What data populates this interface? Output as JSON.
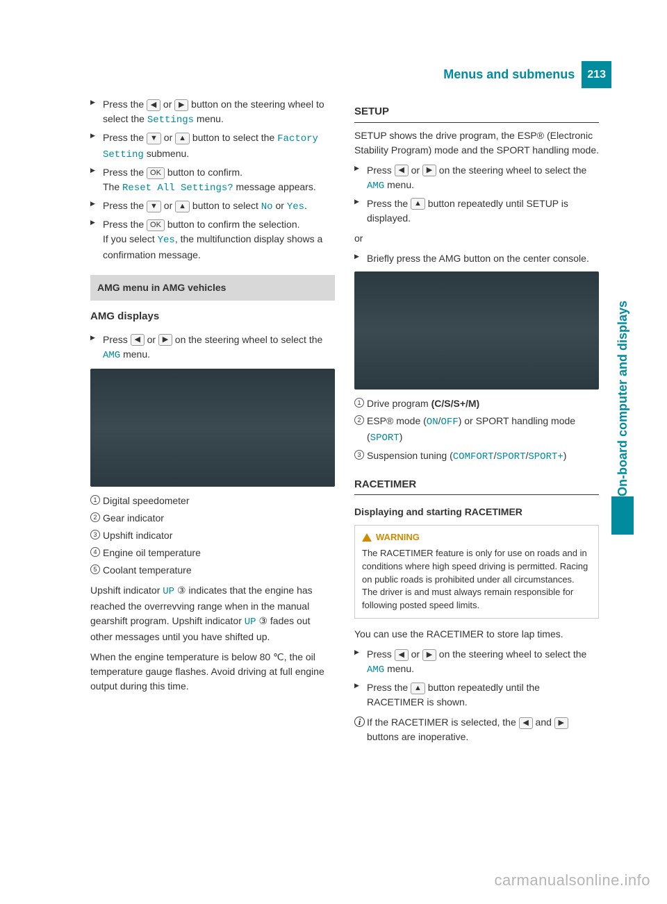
{
  "header": {
    "title": "Menus and submenus",
    "page": "213"
  },
  "side_tab": "On-board computer and displays",
  "left": {
    "steps_a": [
      {
        "pre": "Press the ",
        "b1": "◀",
        "mid1": " or ",
        "b2": "▶",
        "post": " button on the steering wheel to select the ",
        "tt": "Settings",
        "post2": " menu."
      },
      {
        "pre": "Press the ",
        "b1": "▼",
        "mid1": " or ",
        "b2": "▲",
        "post": " button to select the ",
        "tt": "Factory Setting",
        "post2": " submenu."
      },
      {
        "pre": "Press the ",
        "b1": "OK",
        "post": " button to confirm.",
        "br": true,
        "after_pre": "The ",
        "after_tt": "Reset All Settings?",
        "after_post": " message appears."
      },
      {
        "pre": "Press the ",
        "b1": "▼",
        "mid1": " or ",
        "b2": "▲",
        "post": " button to select ",
        "tt": "No",
        "mid2": " or ",
        "tt2": "Yes",
        "post2": "."
      },
      {
        "pre": "Press the ",
        "b1": "OK",
        "post": " button to confirm the selection.",
        "br": true,
        "after_pre": "If you select ",
        "after_tt": "Yes",
        "after_post": ", the multifunction display shows a confirmation message."
      }
    ],
    "section_bar": "AMG menu in AMG vehicles",
    "amg_displays": "AMG displays",
    "step_b": {
      "pre": "Press ",
      "b1": "◀",
      "mid1": " or ",
      "b2": "▶",
      "post": " on the steering wheel to select the ",
      "tt": "AMG",
      "post2": " menu."
    },
    "callouts": [
      {
        "n": "1",
        "t": "Digital speedometer"
      },
      {
        "n": "2",
        "t": "Gear indicator"
      },
      {
        "n": "3",
        "t": "Upshift indicator"
      },
      {
        "n": "4",
        "t": "Engine oil temperature"
      },
      {
        "n": "5",
        "t": "Coolant temperature"
      }
    ],
    "para1_a": "Upshift indicator ",
    "para1_tt": "UP",
    "para1_b": " ③ indicates that the engine has reached the overrevving range when in the manual gearshift program. Upshift indicator ",
    "para1_tt2": "UP",
    "para1_c": " ③ fades out other messages until you have shifted up.",
    "para2": "When the engine temperature is below 80 ℃, the oil temperature gauge flashes. Avoid driving at full engine output during this time."
  },
  "right": {
    "setup_h": "SETUP",
    "setup_p": "SETUP shows the drive program, the ESP® (Electronic Stability Program) mode and the SPORT handling mode.",
    "setup_s1": {
      "pre": "Press ",
      "b1": "◀",
      "mid1": " or ",
      "b2": "▶",
      "post": " on the steering wheel to select the ",
      "tt": "AMG",
      "post2": " menu."
    },
    "setup_s2": {
      "pre": "Press the ",
      "b1": "▲",
      "post": " button repeatedly until SETUP is displayed."
    },
    "or": "or",
    "setup_s3": "Briefly press the AMG button on the center console.",
    "callouts": [
      {
        "n": "1",
        "html": "Drive program <b>(C/S/S+/M)</b>"
      },
      {
        "n": "2",
        "html": "ESP® mode (<span class='tt'>ON</span>/<span class='tt'>OFF</span>) or SPORT handling mode (<span class='tt'>SPORT</span>)"
      },
      {
        "n": "3",
        "html": "Suspension tuning (<span class='tt'>COMFORT</span>/<span class='tt'>SPORT</span>/<span class='tt'>SPORT+</span>)"
      }
    ],
    "race_h": "RACETIMER",
    "race_sub": "Displaying and starting RACETIMER",
    "warn_h": "WARNING",
    "warn_t": "The RACETIMER feature is only for use on roads and in conditions where high speed driving is permitted. Racing on public roads is prohibited under all circumstances. The driver is and must always remain responsible for following posted speed limits.",
    "race_p": "You can use the RACETIMER to store lap times.",
    "race_s1": {
      "pre": "Press ",
      "b1": "◀",
      "mid1": " or ",
      "b2": "▶",
      "post": " on the steering wheel to select the ",
      "tt": "AMG",
      "post2": " menu."
    },
    "race_s2": {
      "pre": "Press the ",
      "b1": "▲",
      "post": " button repeatedly until the RACETIMER is shown."
    },
    "info": {
      "pre": "If the RACETIMER is selected, the ",
      "b1": "◀",
      "mid": " and ",
      "b2": "▶",
      "post": " buttons are inoperative."
    }
  },
  "watermark": "carmanualsonline.info"
}
